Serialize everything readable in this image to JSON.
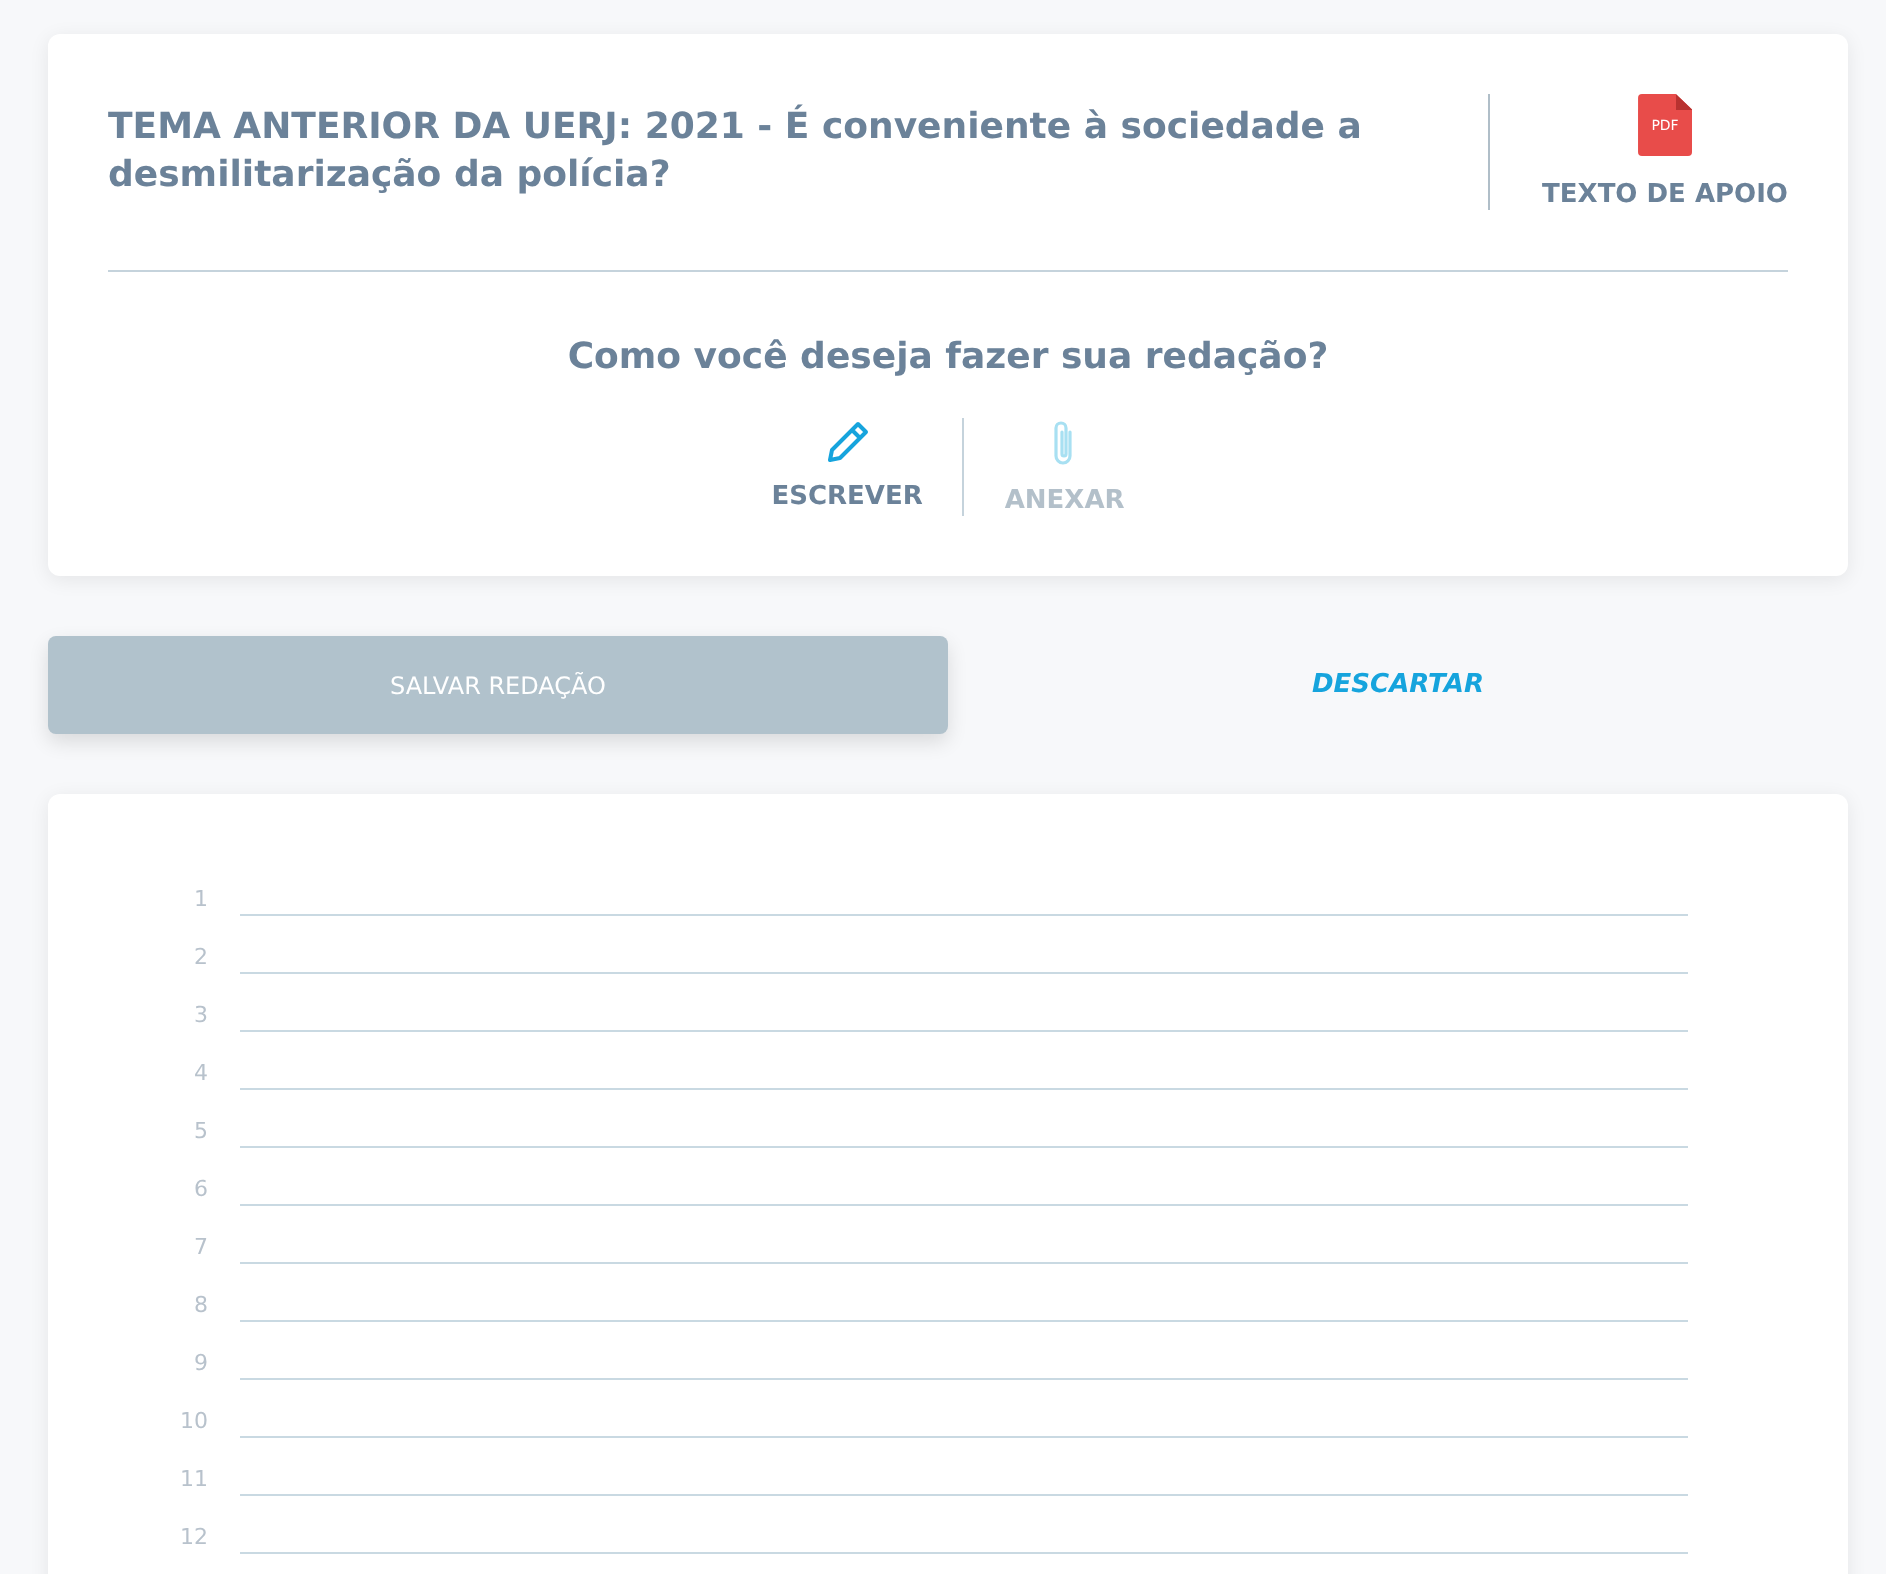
{
  "theme": {
    "title": "TEMA ANTERIOR DA UERJ: 2021 - É conveniente à sociedade a desmilitarização da polícia?",
    "support": {
      "badge": "PDF",
      "label": "TEXTO DE APOIO"
    }
  },
  "question": "Como você deseja fazer sua redação?",
  "modes": [
    {
      "kind": "write",
      "label": "ESCREVER",
      "selected": true
    },
    {
      "kind": "attach",
      "label": "ANEXAR",
      "selected": false
    }
  ],
  "save_button": {
    "label": "SALVAR REDAÇÃO",
    "disabled": true
  },
  "discard_link": "DESCARTAR",
  "line_numbers": [
    "1",
    "2",
    "3",
    "4",
    "5",
    "6",
    "7",
    "8",
    "9",
    "10",
    "11",
    "12"
  ]
}
